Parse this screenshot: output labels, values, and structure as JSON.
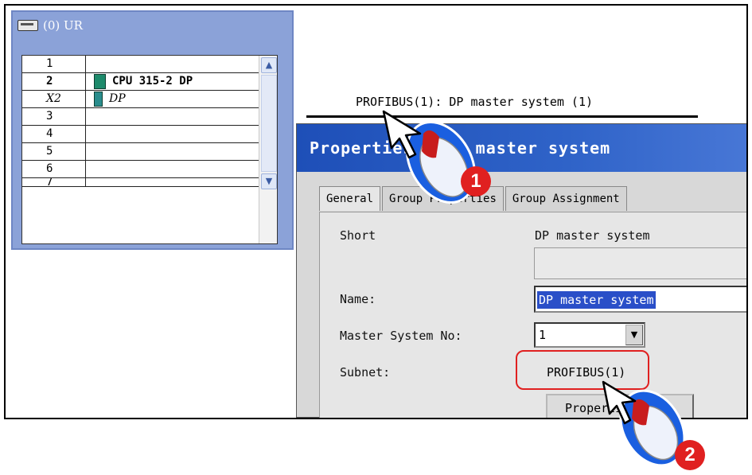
{
  "rack": {
    "title": "(0) UR",
    "rows": [
      {
        "slot": "1",
        "module": ""
      },
      {
        "slot": "2",
        "module": "CPU 315-2 DP"
      },
      {
        "slot": "X2",
        "module": "DP"
      },
      {
        "slot": "3",
        "module": ""
      },
      {
        "slot": "4",
        "module": ""
      },
      {
        "slot": "5",
        "module": ""
      },
      {
        "slot": "6",
        "module": ""
      },
      {
        "slot": "7",
        "module": ""
      }
    ]
  },
  "bus": {
    "label": "PROFIBUS(1): DP master system (1)"
  },
  "dialog": {
    "title": "Properties - DP master system",
    "tabs": [
      "General",
      "Group Properties",
      "Group Assignment"
    ],
    "short_label": "Short",
    "short_value": "DP master system",
    "name_label": "Name:",
    "name_value": "DP master system",
    "master_no_label": "Master System No:",
    "master_no_value": "1",
    "subnet_label": "Subnet:",
    "subnet_value": "PROFIBUS(1)",
    "properties_button": "Properties..."
  },
  "annotations": {
    "step1": "1",
    "step2": "2"
  },
  "colors": {
    "annotation_red": "#e02020",
    "mouse_blue": "#1a5fe0",
    "title_blue": "#1e4fb8"
  }
}
